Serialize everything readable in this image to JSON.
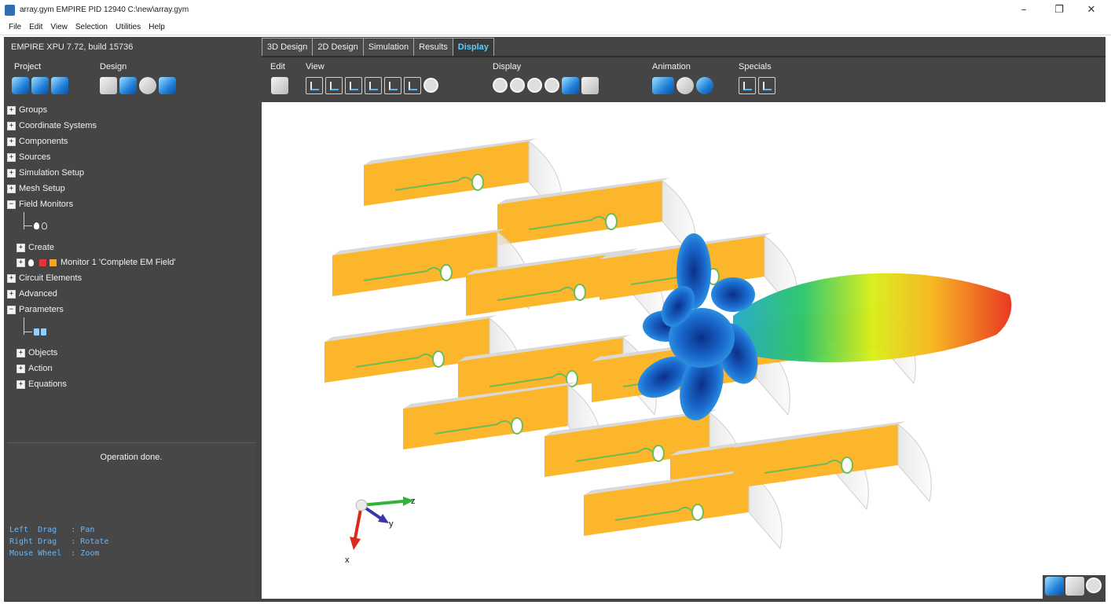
{
  "window": {
    "title": "array.gym EMPIRE PID 12940 C:\\new\\array.gym",
    "minimize": "–",
    "restore": "❐",
    "close": "✕"
  },
  "menu": [
    "File",
    "Edit",
    "View",
    "Selection",
    "Utilities",
    "Help"
  ],
  "version": "EMPIRE XPU 7.72, build 15736",
  "tabs": [
    {
      "label": "3D Design"
    },
    {
      "label": "2D Design"
    },
    {
      "label": "Simulation"
    },
    {
      "label": "Results"
    },
    {
      "label": "Display"
    }
  ],
  "toolbar": {
    "project": "Project",
    "design": "Design",
    "edit": "Edit",
    "view": "View",
    "display": "Display",
    "animation": "Animation",
    "specials": "Specials"
  },
  "tree": {
    "groups": "Groups",
    "coordinate_systems": "Coordinate Systems",
    "components": "Components",
    "sources": "Sources",
    "simulation_setup": "Simulation Setup",
    "mesh_setup": "Mesh Setup",
    "field_monitors": "Field Monitors",
    "create": "Create",
    "monitor": "Monitor 1 'Complete EM Field'",
    "circuit_elements": "Circuit Elements",
    "advanced": "Advanced",
    "parameters": "Parameters",
    "objects": "Objects",
    "action": "Action",
    "equations": "Equations",
    "expanded_sign": "−",
    "collapsed_sign": "+"
  },
  "status": {
    "message": "Operation done.",
    "help": "Left  Drag   : Pan\nRight Drag   : Rotate\nMouse Wheel  : Zoom"
  },
  "axes": {
    "z": "z",
    "y": "y",
    "x": "x"
  },
  "colors": {
    "panel": "#454545",
    "active_tab": "#5ecbff",
    "antenna": "#fbb62b",
    "lobe_main": "#1b6ed1",
    "help_text": "#64b8ff"
  },
  "icons": {
    "project": [
      "open-icon",
      "save-icon",
      "import-icon"
    ],
    "design": [
      "cube-icon",
      "bar-chart-icon",
      "gear-icon",
      "export-icon"
    ],
    "edit": [
      "select-icon"
    ],
    "view": [
      "view-xy-icon",
      "view-yz-icon",
      "view-xz-icon",
      "view-axis-1-icon",
      "view-axis-2-icon",
      "view-axis-3-icon",
      "zoom-view-icon"
    ],
    "display": [
      "rotate-icon",
      "zoom-in-icon",
      "zoom-out-icon",
      "zoom-fit-icon",
      "render-icon",
      "field-display-icon"
    ],
    "animation": [
      "animate-icon",
      "stop-icon",
      "play-icon"
    ],
    "specials": [
      "cut-plane-icon",
      "probe-icon"
    ],
    "corner": [
      "fit-icon",
      "rotate-view-icon",
      "zoom-icon"
    ]
  }
}
